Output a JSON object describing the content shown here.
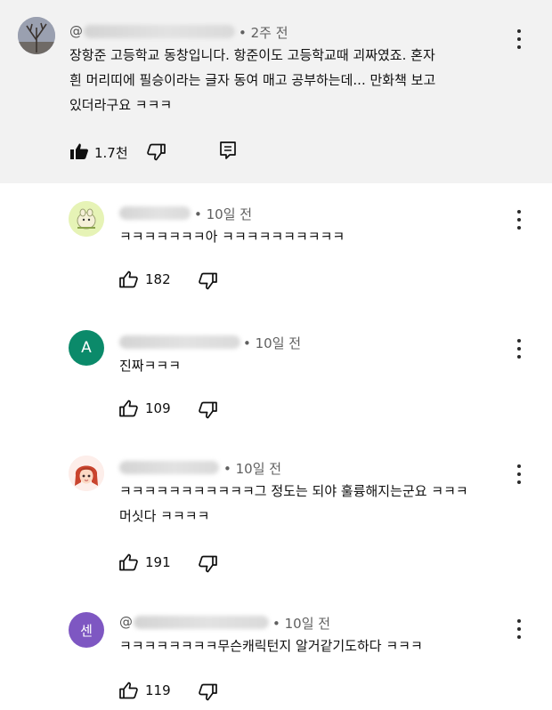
{
  "main_comment": {
    "handle_prefix": "@",
    "time": "• 2주 전",
    "lines": [
      "장항준 고등학교 동창입니다. 항준이도 고등학교때 괴짜였죠. 혼자",
      "흰 머리띠에 필승이라는 글자 동여 매고 공부하는데... 만화책 보고",
      "있더라구요 ㅋㅋㅋ"
    ],
    "likes": "1.7천"
  },
  "replies": [
    {
      "handle_prefix": "",
      "time": "• 10일 전",
      "lines": [
        "ㅋㅋㅋㅋㅋㅋㅋ아 ㅋㅋㅋㅋㅋㅋㅋㅋㅋㅋ"
      ],
      "likes": "182",
      "avatar_letter": ""
    },
    {
      "handle_prefix": "",
      "time": "• 10일 전",
      "lines": [
        "진짜ㅋㅋㅋ"
      ],
      "likes": "109",
      "avatar_letter": "A",
      "avatar_color": "#0b8a6a"
    },
    {
      "handle_prefix": "",
      "time": "• 10일 전",
      "lines": [
        "ㅋㅋㅋㅋㅋㅋㅋㅋㅋㅋㅋ그 정도는 되야 훌륭해지는군요 ㅋㅋㅋ",
        "머싯다 ㅋㅋㅋㅋ"
      ],
      "likes": "191",
      "avatar_letter": ""
    },
    {
      "handle_prefix": "@",
      "time": "• 10일 전",
      "lines": [
        "ㅋㅋㅋㅋㅋㅋㅋㅋ무슨캐릭턴지 알거같기도하다 ㅋㅋㅋ"
      ],
      "likes": "119",
      "avatar_letter": "센",
      "avatar_color": "#7e57c2"
    }
  ]
}
